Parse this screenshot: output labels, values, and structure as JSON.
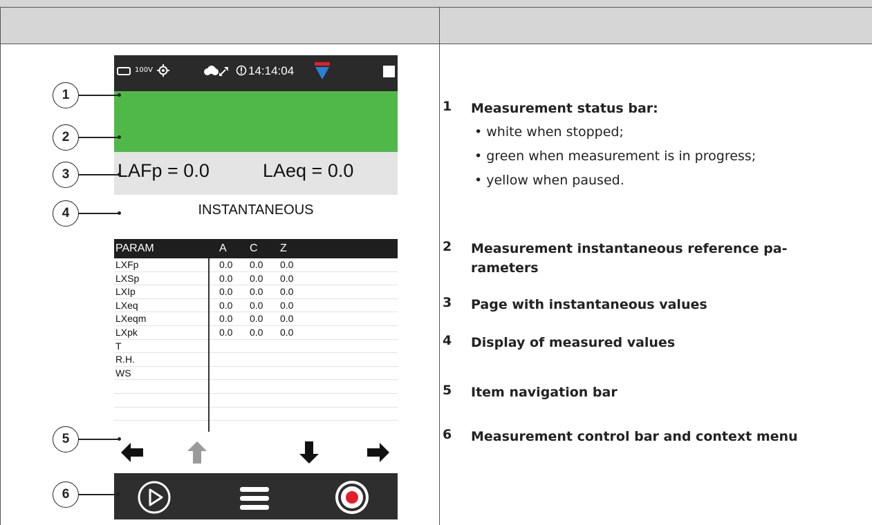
{
  "device": {
    "status": {
      "voltage": "100V",
      "clock": "14:14:04"
    },
    "reference": {
      "left": "LAFp = 0.0",
      "right": "LAeq = 0.0"
    },
    "page_title": "INSTANTANEOUS",
    "table": {
      "headers": [
        "PARAM",
        "A",
        "C",
        "Z"
      ],
      "rows": [
        [
          "LXFp",
          "0.0",
          "0.0",
          "0.0"
        ],
        [
          "LXSp",
          "0.0",
          "0.0",
          "0.0"
        ],
        [
          "LXIp",
          "0.0",
          "0.0",
          "0.0"
        ],
        [
          "LXeq",
          "0.0",
          "0.0",
          "0.0"
        ],
        [
          "LXeqm",
          "0.0",
          "0.0",
          "0.0"
        ],
        [
          "LXpk",
          "0.0",
          "0.0",
          "0.0"
        ],
        [
          "T",
          "",
          "",
          ""
        ],
        [
          "R.H.",
          "",
          "",
          ""
        ],
        [
          "WS",
          "",
          "",
          ""
        ],
        [
          "",
          "",
          "",
          ""
        ],
        [
          "",
          "",
          "",
          ""
        ],
        [
          "",
          "",
          "",
          ""
        ],
        [
          "",
          "",
          "",
          ""
        ]
      ]
    },
    "colors": {
      "status_bar": "#2a2a2a",
      "measurement_bar": "#50b849",
      "record": "#e41e26",
      "level_indicator": "#2b7fd6"
    }
  },
  "callouts": [
    "1",
    "2",
    "3",
    "4",
    "5",
    "6"
  ],
  "legend": [
    {
      "num": "1",
      "title": "Measurement status bar:",
      "bullets": [
        "• white when stopped;",
        "• green when measurement is in progress;",
        "• yellow when paused."
      ]
    },
    {
      "num": "2",
      "title_line1": "Measurement instantaneous reference pa-",
      "title_line2": "rameters"
    },
    {
      "num": "3",
      "title": "Page with instantaneous values"
    },
    {
      "num": "4",
      "title": "Display of measured values"
    },
    {
      "num": "5",
      "title": "Item navigation bar"
    },
    {
      "num": "6",
      "title": "Measurement control bar and context menu"
    }
  ]
}
